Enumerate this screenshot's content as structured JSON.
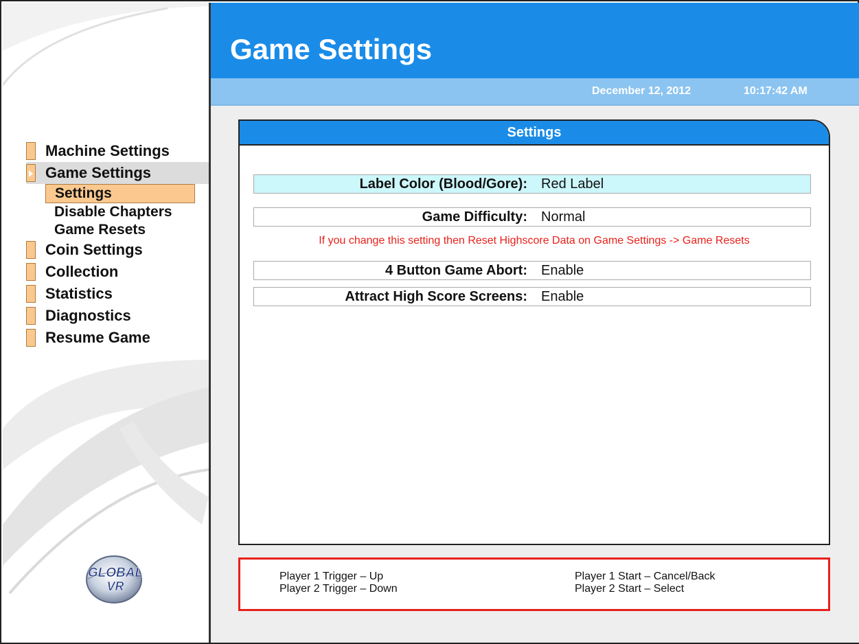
{
  "header": {
    "title": "Game Settings",
    "date": "December 12, 2012",
    "time": "10:17:42 AM"
  },
  "sidebar": {
    "items": [
      {
        "label": "Machine Settings"
      },
      {
        "label": "Game Settings"
      },
      {
        "label": "Coin Settings"
      },
      {
        "label": "Collection"
      },
      {
        "label": "Statistics"
      },
      {
        "label": "Diagnostics"
      },
      {
        "label": "Resume Game"
      }
    ],
    "sub_items": [
      {
        "label": "Settings"
      },
      {
        "label": "Disable Chapters"
      },
      {
        "label": "Game Resets"
      }
    ],
    "logo": {
      "line1": "GLOBAL",
      "line2": "VR"
    }
  },
  "panel": {
    "title": "Settings",
    "rows": [
      {
        "label": "Label Color (Blood/Gore):",
        "value": "Red Label"
      },
      {
        "label": "Game Difficulty:",
        "value": "Normal"
      },
      {
        "label": "4 Button Game Abort:",
        "value": "Enable"
      },
      {
        "label": "Attract High Score Screens:",
        "value": "Enable"
      }
    ],
    "warning": "If you change this setting then Reset Highscore Data on Game Settings -> Game Resets"
  },
  "controls": {
    "p1_trigger": "Player 1 Trigger – Up",
    "p2_trigger": "Player 2 Trigger – Down",
    "p1_start": "Player 1 Start – Cancel/Back",
    "p2_start": "Player 2 Start – Select"
  },
  "colors": {
    "accent": "#1a8ce8",
    "highlight": "#ccf7fb",
    "menu_box": "#fbc98f",
    "warning": "#e8201a"
  }
}
